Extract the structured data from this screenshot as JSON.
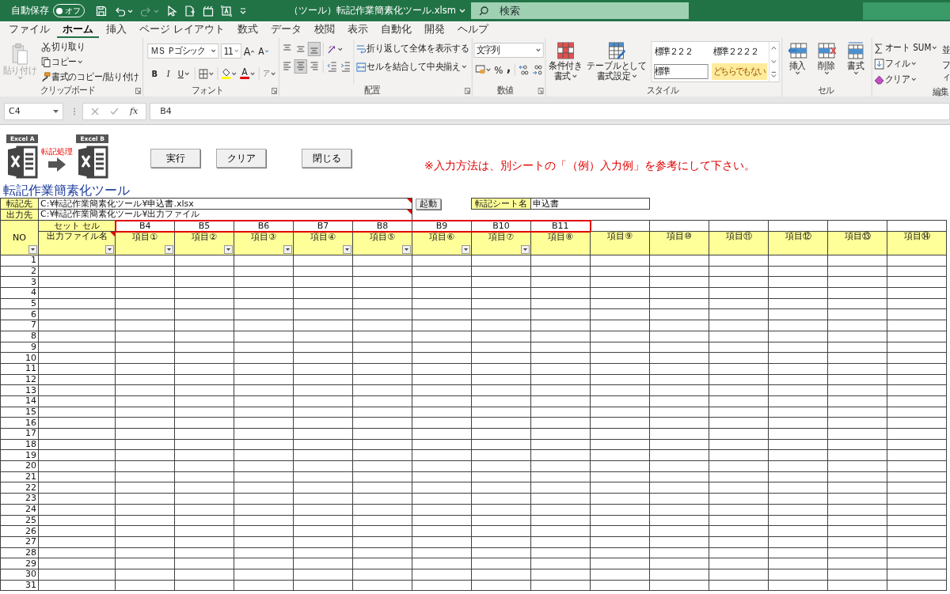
{
  "title_bar": {
    "autosave_label": "自動保存",
    "autosave": {
      "on": false,
      "label": "オフ"
    },
    "quick_access": [
      {
        "kind": "save",
        "disabled": false
      },
      {
        "kind": "undo",
        "disabled": false
      },
      {
        "kind": "redo",
        "disabled": true
      },
      {
        "kind": "pointer",
        "disabled": false
      },
      {
        "kind": "document",
        "disabled": false
      },
      {
        "kind": "board",
        "disabled": false
      },
      {
        "kind": "frame",
        "disabled": false
      },
      {
        "kind": "customize",
        "disabled": false
      }
    ],
    "filename": "（ツール）転記作業簡素化ツール.xlsm",
    "search_placeholder": "検索"
  },
  "tabs": [
    {
      "label": "ファイル",
      "selected": false
    },
    {
      "label": "ホーム",
      "selected": true
    },
    {
      "label": "挿入",
      "selected": false
    },
    {
      "label": "ページ レイアウト",
      "selected": false
    },
    {
      "label": "数式",
      "selected": false
    },
    {
      "label": "データ",
      "selected": false
    },
    {
      "label": "校閲",
      "selected": false
    },
    {
      "label": "表示",
      "selected": false
    },
    {
      "label": "自動化",
      "selected": false
    },
    {
      "label": "開発",
      "selected": false
    },
    {
      "label": "ヘルプ",
      "selected": false
    }
  ],
  "ribbon": {
    "groups": [
      {
        "kind": "clipboard",
        "label": "クリップボード",
        "paste": {
          "label": "貼り付け",
          "disabled": true
        },
        "items": [
          {
            "kind": "cut",
            "label": "切り取り"
          },
          {
            "kind": "copy",
            "label": "コピー"
          },
          {
            "kind": "painter",
            "label": "書式のコピー/貼り付け"
          }
        ]
      },
      {
        "kind": "font",
        "label": "フォント",
        "font_name": "ＭＳ Ｐゴシック",
        "font_size": "11",
        "grow_label": "A",
        "shrink_label": "A",
        "bold_label": "B",
        "italic_label": "I",
        "underline_label": "U",
        "color_label": "A",
        "phonetic_label": "ア"
      },
      {
        "kind": "alignment",
        "label": "配置",
        "vertical": [
          {
            "selected": false
          },
          {
            "selected": false
          },
          {
            "selected": true
          }
        ],
        "horizontal": [
          {
            "selected": false
          },
          {
            "selected": true
          },
          {
            "selected": false
          }
        ],
        "wrap": "折り返して全体を表示する",
        "merge": "セルを結合して中央揃え"
      },
      {
        "kind": "number",
        "label": "数値",
        "format": "文字列",
        "percent_label": "%",
        "comma_label": ","
      },
      {
        "kind": "styles",
        "label": "スタイル",
        "commands": [
          [
            "条件付き",
            "書式"
          ],
          [
            "テーブルとして",
            "書式設定"
          ]
        ],
        "gallery": [
          {
            "label": "標準２２２",
            "selected": false,
            "color": "#ffffff"
          },
          {
            "label": "標準２２２２",
            "selected": false,
            "color": "#ffffff"
          },
          {
            "label": "標準",
            "selected": true,
            "color": "#ffffff"
          },
          {
            "label": "どちらでもない",
            "selected": false,
            "color": "#ffeb9c"
          }
        ]
      },
      {
        "kind": "cells",
        "label": "セル",
        "commands": [
          {
            "kind": "insert",
            "label": "挿入"
          },
          {
            "kind": "delete",
            "label": "削除"
          },
          {
            "kind": "format",
            "label": "書式"
          }
        ]
      },
      {
        "kind": "editing",
        "label": "編集",
        "commands": [
          {
            "kind": "sum",
            "label": "オート SUM"
          },
          {
            "kind": "fill",
            "label": "フィル"
          },
          {
            "kind": "clear",
            "label": "クリア"
          }
        ],
        "cut_texts": [
          "並",
          "フィ"
        ]
      }
    ]
  },
  "formula_bar": {
    "name_box": "C4",
    "fx_label": "fx",
    "formula": "B4"
  },
  "sheet": {
    "logo": {
      "source_label": "Excel A",
      "process_label": "転記処理",
      "target_label": "Excel B"
    },
    "buttons": [
      {
        "kind": "run",
        "label": "実行"
      },
      {
        "kind": "clear",
        "label": "クリア"
      },
      {
        "kind": "close",
        "label": "閉じる"
      }
    ],
    "note": "※入力方法は、別シートの「（例）入力例」を参考にして下さい。",
    "title": "転記作業簡素化ツール",
    "source": {
      "label": "転記先",
      "value": "C:¥転記作業簡素化ツール¥申込書.xlsx",
      "comment": true
    },
    "launch_button": "起動",
    "sheet_name": {
      "label": "転記シート名",
      "value": "申込書"
    },
    "output": {
      "label": "出力先",
      "value": "C:¥転記作業簡素化ツール¥出力ファイル",
      "comment": true
    },
    "no_header": {
      "label": "NO",
      "filter": true
    },
    "set_cell_header": "セット セル",
    "filename_header": {
      "label": "出力ファイル名",
      "filter": true,
      "comment": true
    },
    "columns": [
      {
        "label": "項目①",
        "set_cell": "B4",
        "highlighted": true,
        "filter": true
      },
      {
        "label": "項目②",
        "set_cell": "B5",
        "highlighted": true,
        "filter": true
      },
      {
        "label": "項目③",
        "set_cell": "B6",
        "highlighted": true,
        "filter": true
      },
      {
        "label": "項目④",
        "set_cell": "B7",
        "highlighted": true,
        "filter": true
      },
      {
        "label": "項目⑤",
        "set_cell": "B8",
        "highlighted": true,
        "filter": true
      },
      {
        "label": "項目⑥",
        "set_cell": "B9",
        "highlighted": true,
        "filter": true
      },
      {
        "label": "項目⑦",
        "set_cell": "B10",
        "highlighted": true,
        "filter": true
      },
      {
        "label": "項目⑧",
        "set_cell": "B11",
        "highlighted": true,
        "filter": false
      },
      {
        "label": "項目⑨",
        "highlighted": false,
        "filter": false
      },
      {
        "label": "項目⑩",
        "highlighted": false,
        "filter": false
      },
      {
        "label": "項目⑪",
        "highlighted": false,
        "filter": false
      },
      {
        "label": "項目⑫",
        "highlighted": false,
        "filter": false
      },
      {
        "label": "項目⑬",
        "highlighted": false,
        "filter": false
      },
      {
        "label": "項目⑭",
        "highlighted": false,
        "filter": false
      }
    ],
    "rows": [
      {
        "no": "1"
      },
      {
        "no": "2"
      },
      {
        "no": "3"
      },
      {
        "no": "4"
      },
      {
        "no": "5"
      },
      {
        "no": "6"
      },
      {
        "no": "7"
      },
      {
        "no": "8"
      },
      {
        "no": "9"
      },
      {
        "no": "10"
      },
      {
        "no": "11"
      },
      {
        "no": "12"
      },
      {
        "no": "13"
      },
      {
        "no": "14"
      },
      {
        "no": "15"
      },
      {
        "no": "16"
      },
      {
        "no": "17"
      },
      {
        "no": "18"
      },
      {
        "no": "19"
      },
      {
        "no": "20"
      },
      {
        "no": "21"
      },
      {
        "no": "22"
      },
      {
        "no": "23"
      },
      {
        "no": "24"
      },
      {
        "no": "25"
      },
      {
        "no": "26"
      },
      {
        "no": "27"
      },
      {
        "no": "28"
      },
      {
        "no": "29"
      },
      {
        "no": "30"
      },
      {
        "no": "31"
      }
    ]
  }
}
